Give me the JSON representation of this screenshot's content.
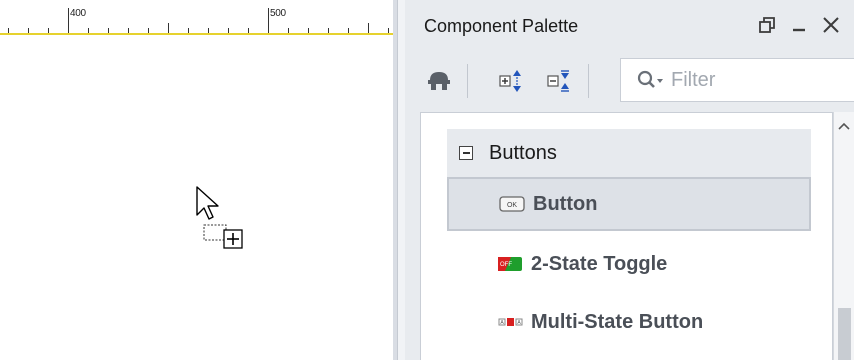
{
  "ruler": {
    "labels": [
      "400",
      "500"
    ]
  },
  "palette": {
    "title": "Component Palette",
    "window_controls": {
      "restore_icon": "restore-icon",
      "minimize_icon": "minimize-icon",
      "close_icon": "close-icon"
    },
    "toolbar": {
      "buttons": [
        "builder-icon",
        "expand-all-icon",
        "collapse-all-icon"
      ],
      "filter": {
        "placeholder": "Filter",
        "value": ""
      }
    },
    "groups": [
      {
        "label": "Buttons",
        "expanded": true,
        "items": [
          {
            "label": "Button",
            "icon": "button-icon",
            "selected": true
          },
          {
            "label": "2-State Toggle",
            "icon": "toggle-icon",
            "selected": false
          },
          {
            "label": "Multi-State Button",
            "icon": "multistate-button-icon",
            "selected": false
          }
        ]
      }
    ]
  },
  "colors": {
    "ruler_line": "#e6d22e",
    "panel_bg": "#e8ebef",
    "selected_bg": "#dde1e7",
    "item_text": "#4a4f57"
  }
}
